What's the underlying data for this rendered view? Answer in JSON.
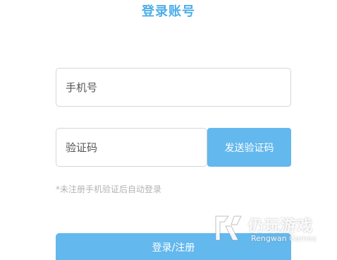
{
  "header": {
    "title": "登录账号"
  },
  "form": {
    "phone_placeholder": "手机号",
    "code_placeholder": "验证码",
    "send_code_label": "发送验证码",
    "hint": "*未注册手机验证后自动登录",
    "login_label": "登录/注册"
  },
  "watermark": {
    "cn": "仍玩游戏",
    "en": "Rengwan Games"
  },
  "colors": {
    "accent": "#4eaee8",
    "button": "#63b8ee",
    "border": "#d6d6d6",
    "hint": "#b3b3b3"
  }
}
